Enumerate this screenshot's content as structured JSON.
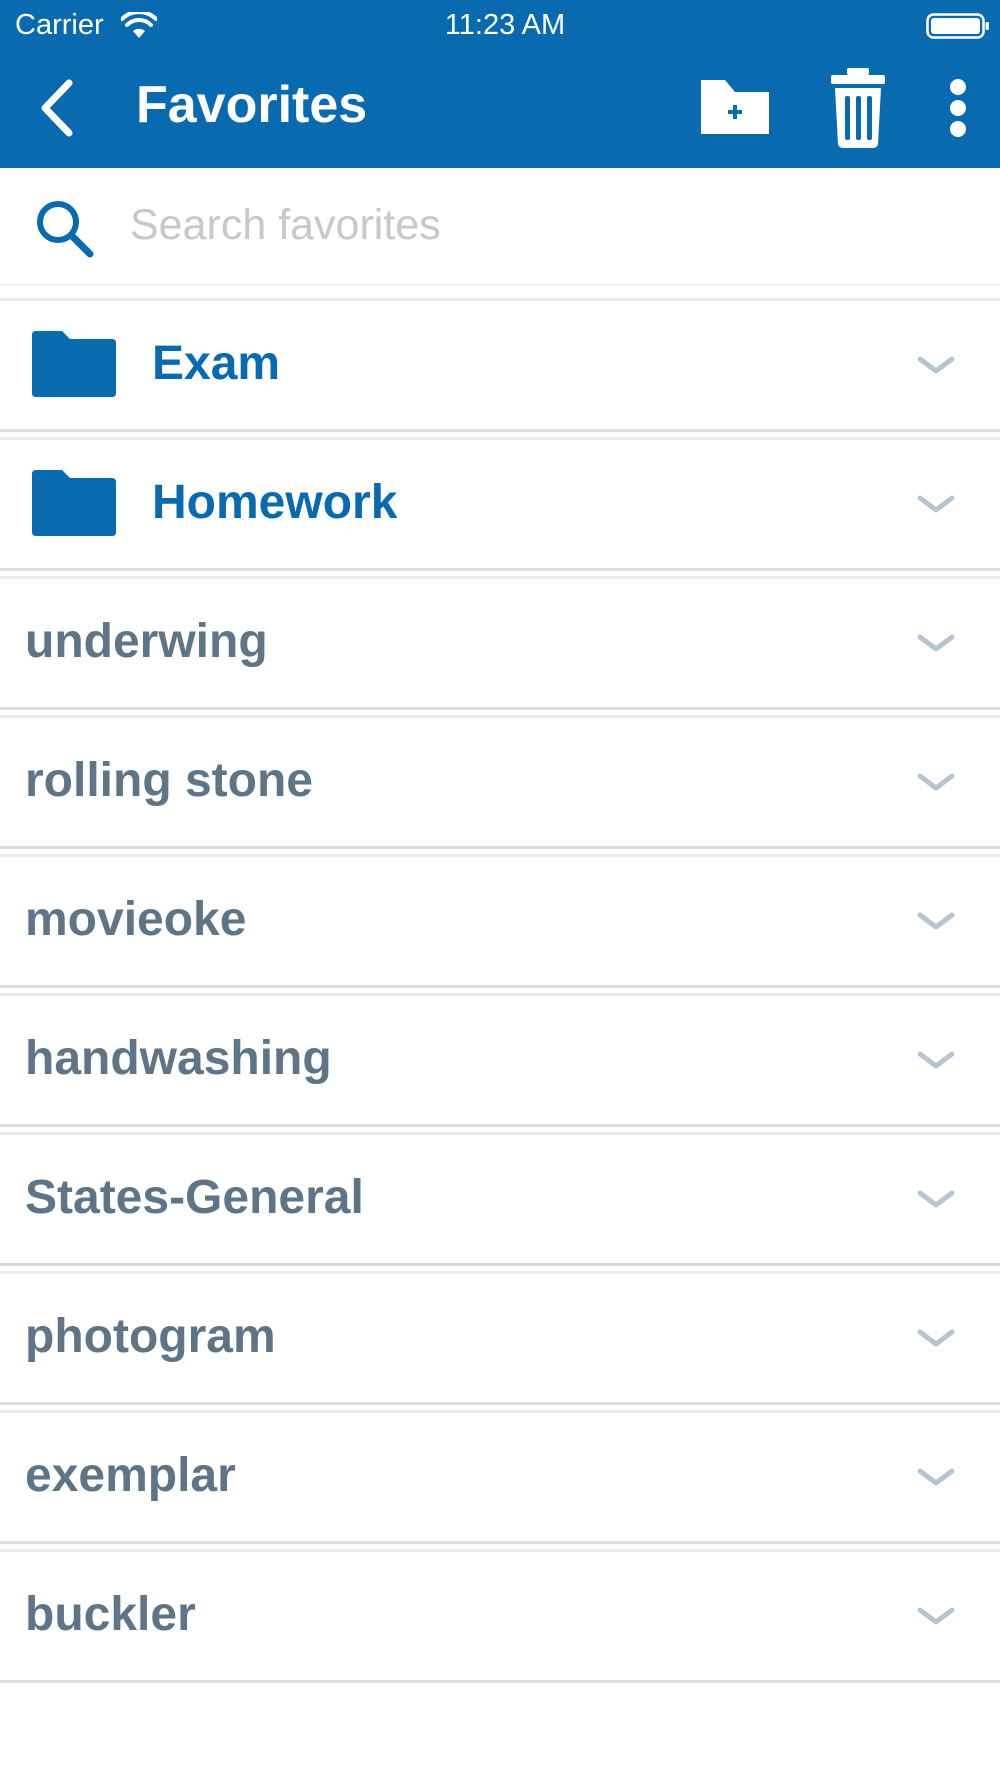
{
  "status_bar": {
    "carrier": "Carrier",
    "time": "11:23 AM"
  },
  "nav": {
    "title": "Favorites",
    "back_icon": "chevron-left-icon",
    "actions": [
      "new-folder-icon",
      "trash-icon",
      "more-vertical-icon"
    ]
  },
  "search": {
    "placeholder": "Search favorites",
    "value": ""
  },
  "folders": [
    {
      "label": "Exam"
    },
    {
      "label": "Homework"
    }
  ],
  "words": [
    {
      "label": "underwing"
    },
    {
      "label": "rolling stone"
    },
    {
      "label": "movieoke"
    },
    {
      "label": "handwashing"
    },
    {
      "label": "States-General"
    },
    {
      "label": "photogram"
    },
    {
      "label": "exemplar"
    },
    {
      "label": "buckler"
    }
  ],
  "colors": {
    "primary": "#0a6ab0",
    "word_text": "#5e7587",
    "chevron": "#b7c4d1",
    "placeholder": "#c7c7cc"
  }
}
